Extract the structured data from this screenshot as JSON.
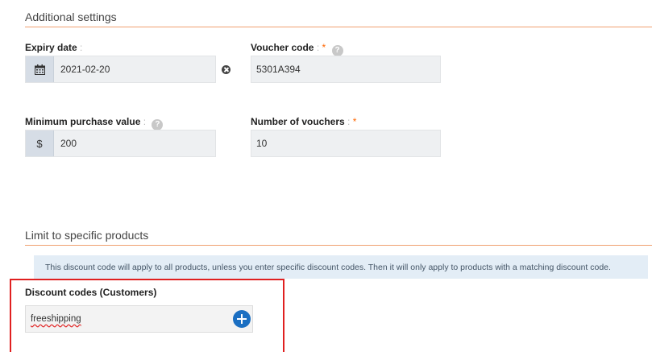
{
  "additional": {
    "title": "Additional settings",
    "expiry": {
      "label": "Expiry date",
      "colon": ":",
      "value": "2021-02-20",
      "addon_icon": "calendar-icon"
    },
    "voucher": {
      "label": "Voucher code",
      "colon": ":",
      "required": "*",
      "help": "?",
      "value": "5301A394"
    },
    "minimum": {
      "label": "Minimum purchase value",
      "colon": ":",
      "help": "?",
      "addon": "$",
      "value": "200"
    },
    "number": {
      "label": "Number of vouchers",
      "colon": ":",
      "required": "*",
      "value": "10"
    }
  },
  "limit": {
    "title": "Limit to specific products",
    "info": "This discount code will apply to all products, unless you enter specific discount codes. Then it will only apply to products with a matching discount code.",
    "codes": {
      "label": "Discount codes (Customers)",
      "value": "freeshipping"
    }
  },
  "colors": {
    "accent_line": "#f0a070",
    "required": "#ff6600",
    "highlight": "#e02020",
    "add_button": "#1b6fc2",
    "info_bg": "#e3edf6"
  }
}
